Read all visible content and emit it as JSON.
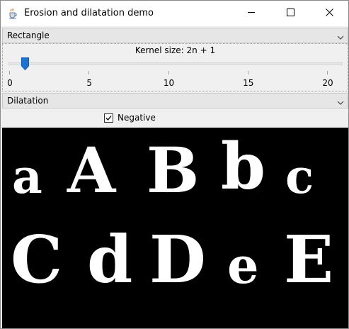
{
  "window": {
    "title": "Erosion and dilatation demo"
  },
  "icons": {
    "app": "java-cup-icon",
    "minimize": "minimize-icon",
    "maximize": "maximize-icon",
    "close": "close-icon",
    "dropdown": "chevron-down-icon",
    "check": "checkmark-icon"
  },
  "controls": {
    "shape_select": {
      "selected": "Rectangle"
    },
    "kernel": {
      "label": "Kernel size: 2n + 1",
      "value": 1,
      "min": 0,
      "max": 21,
      "tick_labels": [
        "0",
        "5",
        "10",
        "15",
        "20"
      ]
    },
    "operation_select": {
      "selected": "Dilatation"
    },
    "negative": {
      "label": "Negative",
      "checked": true
    }
  },
  "image": {
    "row1": [
      "a",
      "A",
      "B",
      "b",
      "c"
    ],
    "row2": [
      "C",
      "d",
      "D",
      "e",
      "E"
    ],
    "background": "#000000",
    "foreground": "#ffffff"
  },
  "colors": {
    "slider_thumb": "#1a73d9",
    "window_bg": "#f0f0f0"
  }
}
